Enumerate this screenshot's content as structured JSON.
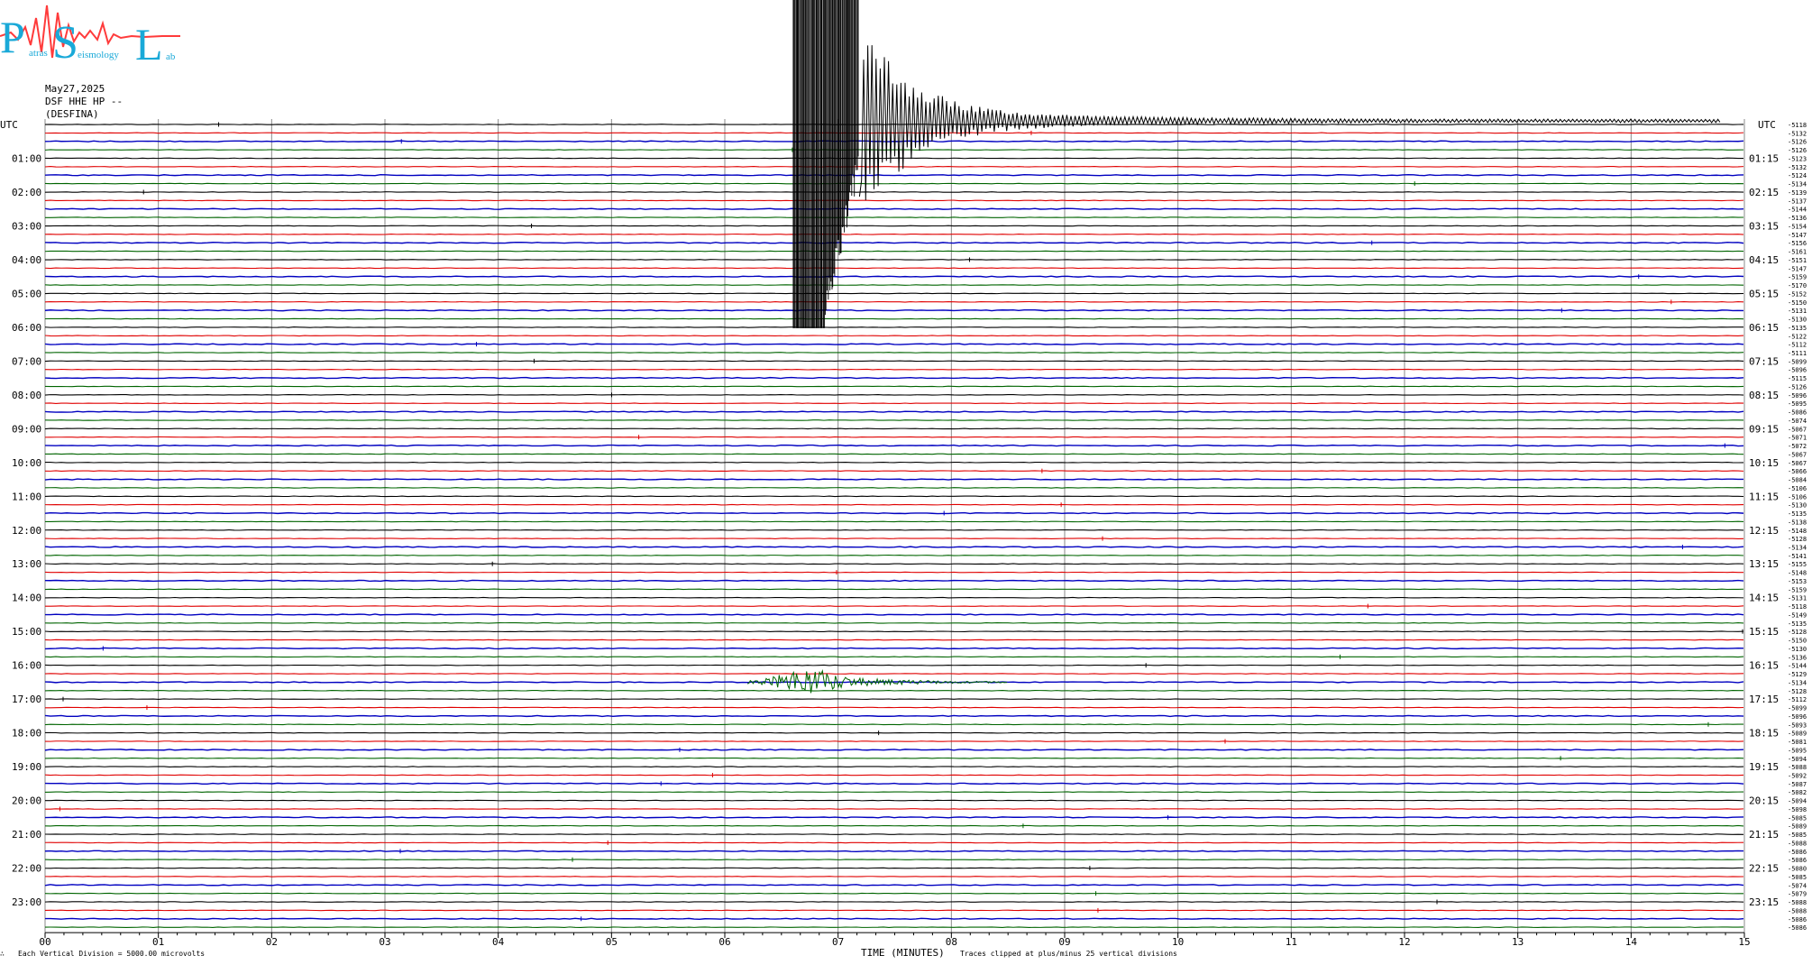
{
  "header": {
    "date": "May27,2025",
    "station_line": "DSF HHE HP --",
    "station_name": "(DESFINA)"
  },
  "logo": {
    "letters": [
      "P",
      "S",
      "L"
    ],
    "words": [
      "atras",
      "eismology",
      "ab"
    ],
    "color": "#19a9d8",
    "wave_color": "#ff3b3b"
  },
  "colors": {
    "trace_cycle": [
      "#000000",
      "#e00000",
      "#0000c0",
      "#006400"
    ],
    "grid": "#8a8a8a",
    "text": "#000000"
  },
  "chart_data": {
    "type": "helicorder",
    "xlabel": "TIME (MINUTES)",
    "xlim": [
      0,
      15
    ],
    "x_ticks": [
      "00",
      "01",
      "02",
      "03",
      "04",
      "05",
      "06",
      "07",
      "08",
      "09",
      "10",
      "11",
      "12",
      "13",
      "14",
      "15"
    ],
    "utc_label": "UTC",
    "left_hour_labels": [
      "01:00",
      "02:00",
      "03:00",
      "04:00",
      "05:00",
      "06:00",
      "07:00",
      "08:00",
      "09:00",
      "10:00",
      "11:00",
      "12:00",
      "13:00",
      "14:00",
      "15:00",
      "16:00",
      "17:00",
      "18:00",
      "19:00",
      "20:00",
      "21:00",
      "22:00",
      "23:00"
    ],
    "right_hour_labels": [
      "01:15",
      "02:15",
      "03:15",
      "04:15",
      "05:15",
      "06:15",
      "07:15",
      "08:15",
      "09:15",
      "10:15",
      "11:15",
      "12:15",
      "13:15",
      "14:15",
      "15:15",
      "16:15",
      "17:15",
      "18:15",
      "19:15",
      "20:15",
      "21:15",
      "22:15",
      "23:15"
    ],
    "minutes_per_line": 15,
    "line_count": 96,
    "line_offsets": [
      "-5118",
      "-5132",
      "-5126",
      "-5126",
      "-5123",
      "-5132",
      "-5124",
      "-5134",
      "-5139",
      "-5137",
      "-5144",
      "-5136",
      "-5154",
      "-5147",
      "-5156",
      "-5161",
      "-5151",
      "-5147",
      "-5159",
      "-5170",
      "-5152",
      "-5150",
      "-5131",
      "-5130",
      "-5135",
      "-5122",
      "-5112",
      "-5111",
      "-5099",
      "-5096",
      "-5115",
      "-5126",
      "-5096",
      "-5095",
      "-5086",
      "-5074",
      "-5067",
      "-5071",
      "-5072",
      "-5067",
      "-5067",
      "-5066",
      "-5084",
      "-5106",
      "-5106",
      "-5130",
      "-5135",
      "-5138",
      "-5148",
      "-5128",
      "-5134",
      "-5141",
      "-5155",
      "-5148",
      "-5153",
      "-5159",
      "-5131",
      "-5118",
      "-5149",
      "-5135",
      "-5128",
      "-5150",
      "-5130",
      "-5136",
      "-5144",
      "-5129",
      "-5134",
      "-5128",
      "-5112",
      "-5099",
      "-5096",
      "-5093",
      "-5089",
      "-5081",
      "-5095",
      "-5094",
      "-5088",
      "-5092",
      "-5087",
      "-5082",
      "-5094",
      "-5098",
      "-5085",
      "-5089",
      "-5085",
      "-5088",
      "-5086",
      "-5086",
      "-5080",
      "-5085",
      "-5074",
      "-5079",
      "-5088",
      "-5088",
      "-5086",
      "-5086"
    ],
    "events": [
      {
        "name": "large earthquake (clipped)",
        "line": 0,
        "start_min": 6.6,
        "end_min": 15,
        "clipped_until_line": 24
      },
      {
        "name": "local event",
        "line": 66,
        "start_min": 6.2,
        "end_min": 8.5
      }
    ],
    "footer_left": "Each Vertical Division = 5000.00 microvolts",
    "footer_right": "Traces clipped at plus/minus 25 vertical divisions",
    "corner_mark": "∴"
  }
}
